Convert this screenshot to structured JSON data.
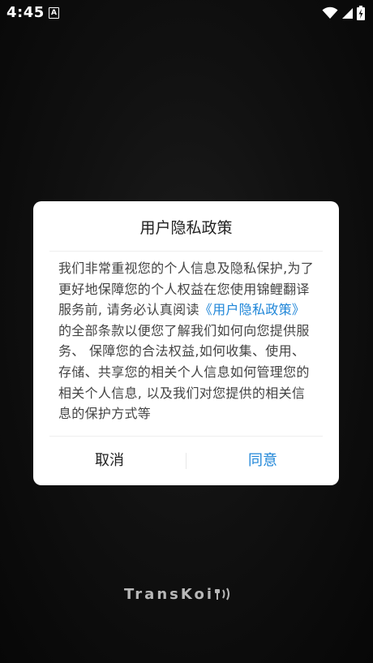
{
  "status_bar": {
    "time": "4:45",
    "notification_icon_letter": "A"
  },
  "dialog": {
    "title": "用户隐私政策",
    "body_before_link": "我们非常重视您的个人信息及隐私保护,为了更好地保障您的个人权益在您使用锦鲤翻译服务前, 请务必认真阅读",
    "link_text": "《用户隐私政策》",
    "body_after_link": "的全部条款以便您了解我们如何向您提供服务、 保障您的合法权益,如何收集、使用、存储、共享您的相关个人信息如何管理您的相关个人信息, 以及我们对您提供的相关信息的保护方式等",
    "cancel_label": "取消",
    "agree_label": "同意"
  },
  "logo": {
    "text": "TransKoi"
  },
  "colors": {
    "accent": "#1f86d8",
    "background": "#0a0a0a",
    "dialog_background": "#ffffff"
  }
}
